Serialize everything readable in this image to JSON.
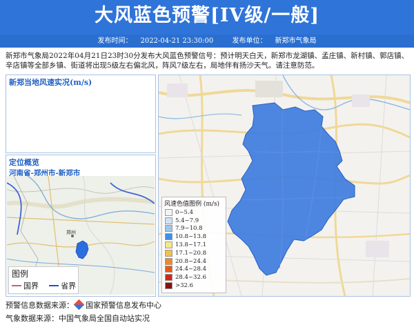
{
  "header": {
    "title": "大风蓝色预警[IV级/一般]",
    "publish_time_label": "发布时间：",
    "publish_time": "2022-04-21 23:30:00",
    "publish_unit_label": "发布单位：",
    "publish_unit": "新郑市气象局"
  },
  "description": "新郑市气象局2022年04月21日23时30分发布大风蓝色预警信号：预计明天白天，新郑市龙湖镇、孟庄镇、新村镇、郭店镇、辛店镇等全部乡镇、街道将出现5级左右偏北风，阵风7级左右，局地伴有扬沙天气。请注意防范。",
  "wind_panel": {
    "title": "新郑当地风速实况(m/s)"
  },
  "location_panel": {
    "title": "定位概览",
    "path": "河南省-郑州市-新郑市",
    "map_label": "郑州"
  },
  "small_legend": {
    "title": "图例",
    "items": [
      {
        "label": "国界",
        "color": "#c0607a"
      },
      {
        "label": "省界",
        "color": "#2050c8"
      }
    ]
  },
  "wind_legend": {
    "title": "风速色值图例 (m/s)",
    "items": [
      {
        "label": "0~5.4",
        "color": "#f4f4f4"
      },
      {
        "label": "5.4~7.9",
        "color": "#cfe2f6"
      },
      {
        "label": "7.9~10.8",
        "color": "#9cc7f0"
      },
      {
        "label": "10.8~13.8",
        "color": "#3f8fe8"
      },
      {
        "label": "13.8~17.1",
        "color": "#f6e78c"
      },
      {
        "label": "17.1~20.8",
        "color": "#f2c14a"
      },
      {
        "label": "20.8~24.4",
        "color": "#ef8a22"
      },
      {
        "label": "24.4~28.4",
        "color": "#e85a17"
      },
      {
        "label": "28.4~32.6",
        "color": "#d32518"
      },
      {
        "label": ">32.6",
        "color": "#8a0f0f"
      }
    ]
  },
  "footer": {
    "warning_source_label": "预警信息数据来源：",
    "warning_source": "国家预警信息发布中心",
    "weather_source_label": "气象数据来源：",
    "weather_source": "中国气象局全国自动站实况"
  },
  "colors": {
    "header_bg": "#2f74d8",
    "warning_fill": "#3f7de0"
  }
}
